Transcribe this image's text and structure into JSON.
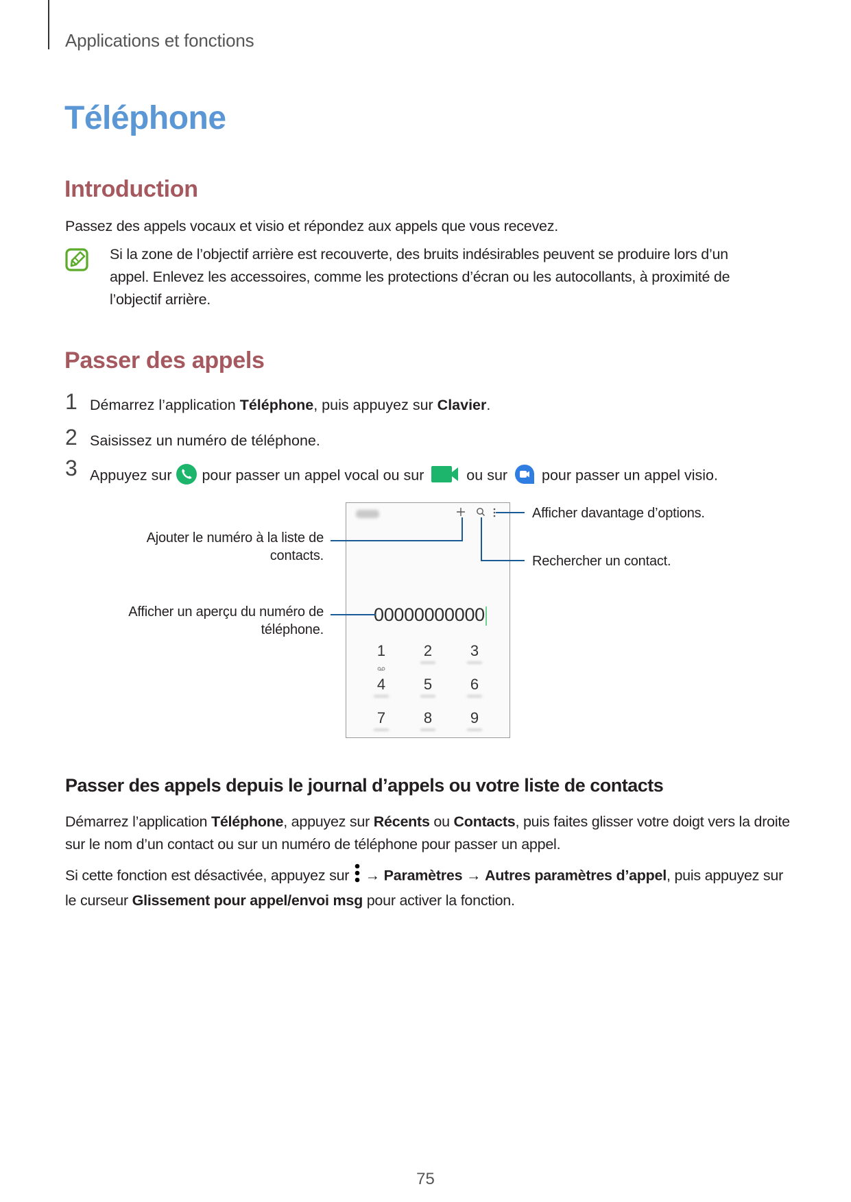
{
  "header": {
    "section_title": "Applications et fonctions"
  },
  "page_title": "Téléphone",
  "introduction": {
    "heading": "Introduction",
    "paragraph": "Passez des appels vocaux et visio et répondez aux appels que vous recevez.",
    "note": {
      "icon": "note-pencil-icon",
      "text": "Si la zone de l’objectif arrière est recouverte, des bruits indésirables peuvent se produire lors d’un appel. Enlevez les accessoires, comme les protections d’écran ou les autocollants, à proximité de l’objectif arrière."
    }
  },
  "passer_des_appels": {
    "heading": "Passer des appels",
    "steps": [
      {
        "num": "1",
        "parts": [
          "Démarrez l’application ",
          "Téléphone",
          ", puis appuyez sur ",
          "Clavier",
          "."
        ]
      },
      {
        "num": "2",
        "text": "Saisissez un numéro de téléphone."
      },
      {
        "num": "3",
        "parts": [
          "Appuyez sur ",
          " pour passer un appel vocal ou sur ",
          " ou sur ",
          " pour passer un appel visio."
        ],
        "icons": [
          "phone-call-icon",
          "video-call-icon",
          "duo-video-icon"
        ]
      }
    ],
    "colors": {
      "call_green": "#1db56c",
      "duo_blue": "#2f7de1",
      "callout_line": "#1a5a96"
    }
  },
  "phone_mockup": {
    "app_title_blurred": "Phone",
    "toolbar_icons": [
      "add-icon",
      "search-icon",
      "more-options-icon"
    ],
    "number_display": "00000000000",
    "keys": [
      {
        "digit": "1",
        "sub": "voicemail"
      },
      {
        "digit": "2"
      },
      {
        "digit": "3"
      },
      {
        "digit": "4"
      },
      {
        "digit": "5"
      },
      {
        "digit": "6"
      },
      {
        "digit": "7"
      },
      {
        "digit": "8"
      },
      {
        "digit": "9"
      }
    ]
  },
  "callouts": {
    "more_options": "Afficher davantage d’options.",
    "search_contact": "Rechercher un contact.",
    "add_contact_line1": "Ajouter le numéro à la liste de",
    "add_contact_line2": "contacts.",
    "preview_line1": "Afficher un aperçu du numéro de",
    "preview_line2": "téléphone."
  },
  "journal_section": {
    "heading": "Passer des appels depuis le journal d’appels ou votre liste de contacts",
    "p1_parts": [
      "Démarrez l’application ",
      "Téléphone",
      ", appuyez sur ",
      "Récents",
      " ou ",
      "Contacts",
      ", puis faites glisser votre doigt vers la droite sur le nom d’un contact ou sur un numéro de téléphone pour passer un appel."
    ],
    "p2_parts": [
      "Si cette fonction est désactivée, appuyez sur ",
      " → ",
      "Paramètres",
      " → ",
      "Autres paramètres d’appel",
      ", puis appuyez sur le curseur ",
      "Glissement pour appel/envoi msg",
      " pour activer la fonction."
    ],
    "p2_icon": "more-options-icon"
  },
  "page_number": "75"
}
